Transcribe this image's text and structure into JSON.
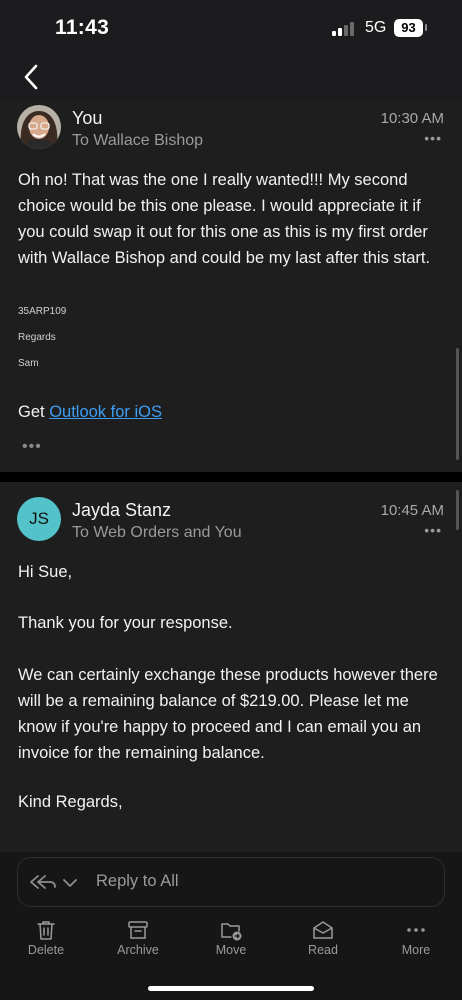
{
  "status": {
    "time": "11:43",
    "network": "5G",
    "battery": "93"
  },
  "messages": [
    {
      "sender": "You",
      "recipient": "To Wallace Bishop",
      "time": "10:30 AM",
      "body": "Oh no! That was the one I really wanted!!! My second choice would be this one please. I would appreciate it if you  could swap it out for this one as this is my first order with Wallace Bishop and could be my last after this start.",
      "signature_lines": [
        "35ARP109",
        "Regards",
        "Sam"
      ],
      "footer_prefix": "Get ",
      "footer_link": "Outlook for iOS"
    },
    {
      "sender": "Jayda Stanz",
      "initials": "JS",
      "recipient": "To Web Orders and You",
      "time": "10:45 AM",
      "greeting": "Hi Sue,",
      "paragraph_1": "Thank you for your response.",
      "paragraph_2": "We can certainly exchange these products however there will be a remaining balance of $219.00. Please let me know if you're happy to proceed and I can email you an invoice for the remaining balance.",
      "closing": "Kind Regards,"
    }
  ],
  "reply": {
    "placeholder": "Reply to All"
  },
  "toolbar": [
    {
      "label": "Delete",
      "icon": "trash-icon"
    },
    {
      "label": "Archive",
      "icon": "archive-icon"
    },
    {
      "label": "Move",
      "icon": "folder-move-icon"
    },
    {
      "label": "Read",
      "icon": "envelope-open-icon"
    },
    {
      "label": "More",
      "icon": "more-dots-icon"
    }
  ],
  "colors": {
    "background": "#1e1e1e",
    "link": "#3e9ef5",
    "avatar_js": "#53c2c9"
  }
}
